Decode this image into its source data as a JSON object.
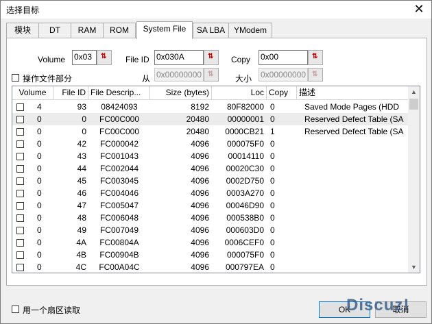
{
  "window": {
    "title": "选择目标",
    "close_glyph": "✕"
  },
  "tabs": [
    {
      "label": "模块",
      "active": false
    },
    {
      "label": "DT",
      "active": false
    },
    {
      "label": "RAM",
      "active": false
    },
    {
      "label": "ROM",
      "active": false
    },
    {
      "label": "System File",
      "active": true
    },
    {
      "label": "SA LBA",
      "active": false
    },
    {
      "label": "YModem",
      "active": false
    }
  ],
  "form": {
    "volume_label": "Volume",
    "volume_value": "0x03",
    "fileid_label": "File ID",
    "fileid_value": "0x030A",
    "copy_label": "Copy",
    "copy_value": "0x00",
    "partial_label": "操作文件部分",
    "from_label": "从",
    "from_value": "0x00000000",
    "size_label": "大小",
    "size_value": "0x00000000",
    "spin_glyph": "⇅"
  },
  "table": {
    "columns": [
      "Volume",
      "File ID",
      "File Descrip...",
      "Size (bytes)",
      "Loc",
      "Copy",
      "描述"
    ],
    "rows": [
      {
        "volume": "4",
        "file_id": "93",
        "desc": "08424093",
        "size": "8192",
        "loc": "80F82000",
        "copy": "0",
        "note": "Saved Mode Pages (HDD"
      },
      {
        "volume": "0",
        "file_id": "0",
        "desc": "FC00C000",
        "size": "20480",
        "loc": "00000001",
        "copy": "0",
        "note": "Reserved Defect Table (SA"
      },
      {
        "volume": "0",
        "file_id": "0",
        "desc": "FC00C000",
        "size": "20480",
        "loc": "0000CB21",
        "copy": "1",
        "note": "Reserved Defect Table (SA"
      },
      {
        "volume": "0",
        "file_id": "42",
        "desc": "FC000042",
        "size": "4096",
        "loc": "000075F0",
        "copy": "0",
        "note": ""
      },
      {
        "volume": "0",
        "file_id": "43",
        "desc": "FC001043",
        "size": "4096",
        "loc": "00014110",
        "copy": "0",
        "note": ""
      },
      {
        "volume": "0",
        "file_id": "44",
        "desc": "FC002044",
        "size": "4096",
        "loc": "00020C30",
        "copy": "0",
        "note": ""
      },
      {
        "volume": "0",
        "file_id": "45",
        "desc": "FC003045",
        "size": "4096",
        "loc": "0002D750",
        "copy": "0",
        "note": ""
      },
      {
        "volume": "0",
        "file_id": "46",
        "desc": "FC004046",
        "size": "4096",
        "loc": "0003A270",
        "copy": "0",
        "note": ""
      },
      {
        "volume": "0",
        "file_id": "47",
        "desc": "FC005047",
        "size": "4096",
        "loc": "00046D90",
        "copy": "0",
        "note": ""
      },
      {
        "volume": "0",
        "file_id": "48",
        "desc": "FC006048",
        "size": "4096",
        "loc": "000538B0",
        "copy": "0",
        "note": ""
      },
      {
        "volume": "0",
        "file_id": "49",
        "desc": "FC007049",
        "size": "4096",
        "loc": "000603D0",
        "copy": "0",
        "note": ""
      },
      {
        "volume": "0",
        "file_id": "4A",
        "desc": "FC00804A",
        "size": "4096",
        "loc": "0006CEF0",
        "copy": "0",
        "note": ""
      },
      {
        "volume": "0",
        "file_id": "4B",
        "desc": "FC00904B",
        "size": "4096",
        "loc": "000075F0",
        "copy": "0",
        "note": ""
      },
      {
        "volume": "0",
        "file_id": "4C",
        "desc": "FC00A04C",
        "size": "4096",
        "loc": "000797EA",
        "copy": "0",
        "note": ""
      }
    ]
  },
  "footer": {
    "single_sector_label": "用一个扇区读取",
    "ok_label": "OK",
    "cancel_label": "取消"
  },
  "watermark": "Discuz!"
}
